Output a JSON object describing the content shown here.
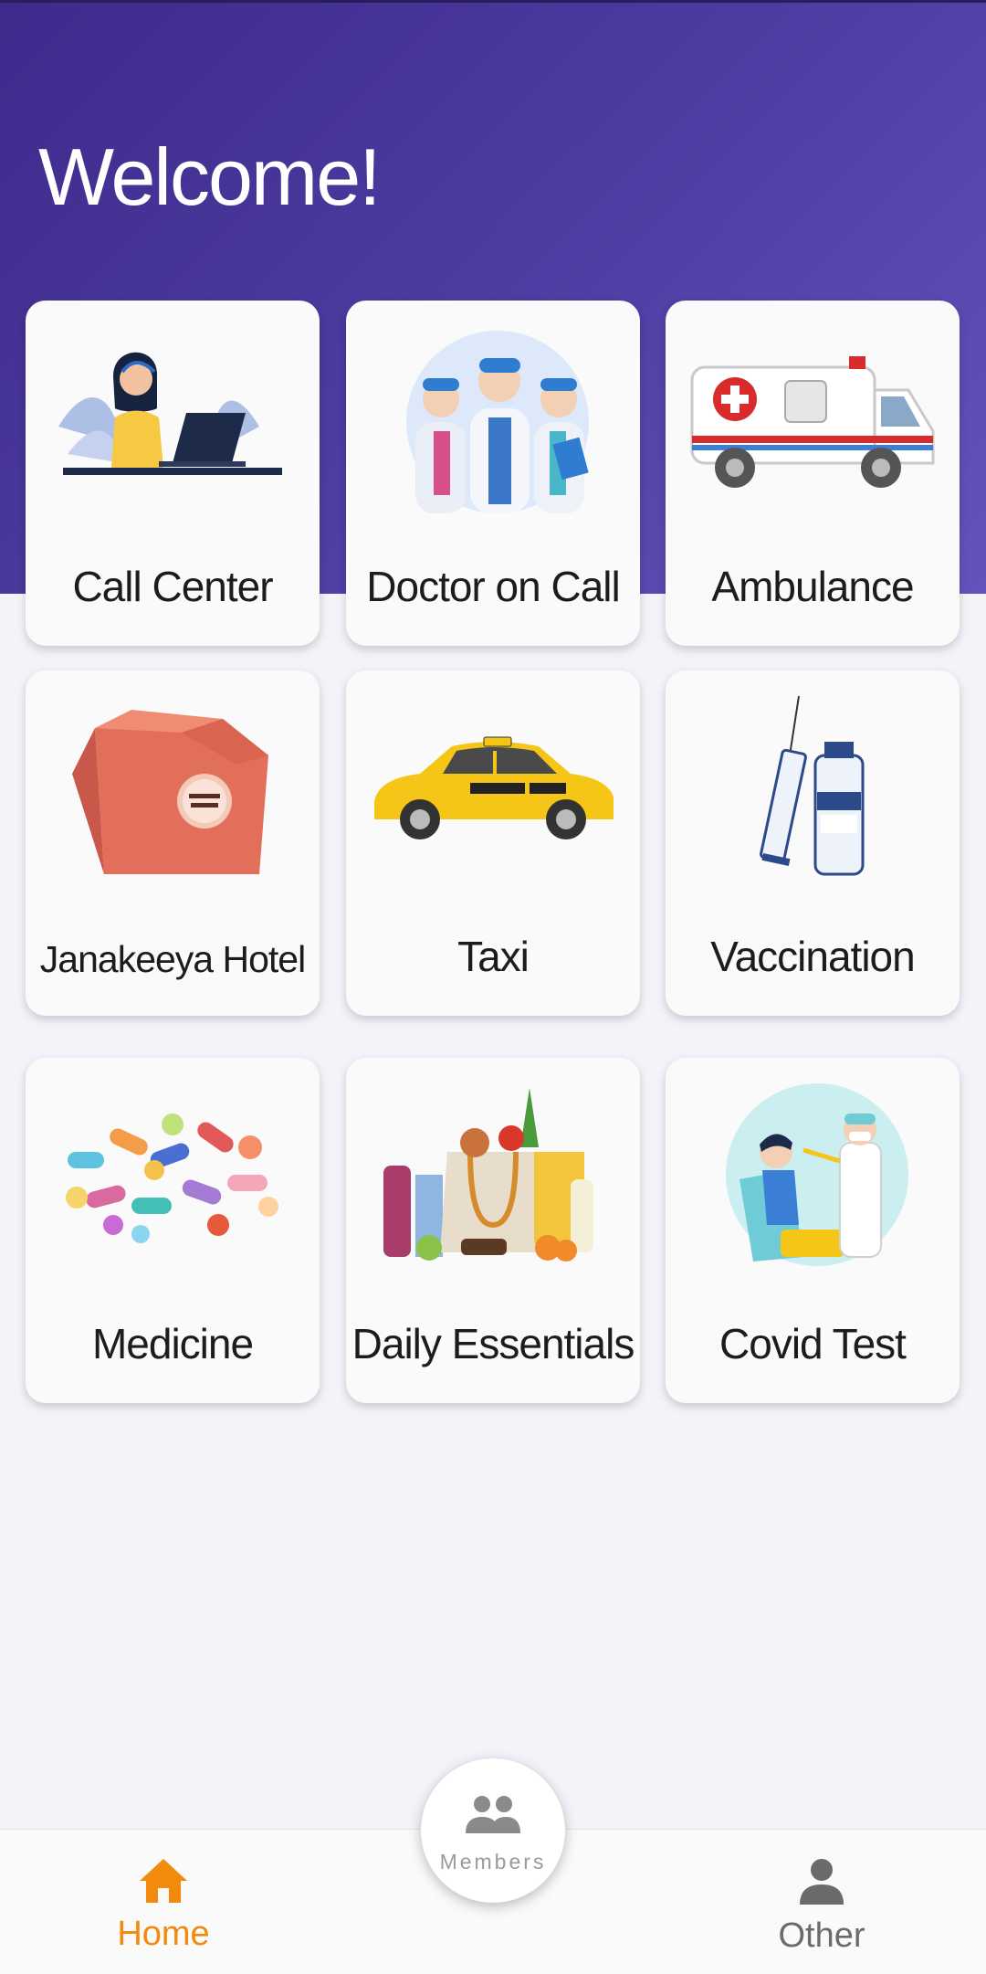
{
  "header": {
    "title": "Welcome!"
  },
  "services": [
    {
      "label": "Call Center",
      "icon": "call-center-agent-icon"
    },
    {
      "label": "Doctor on Call",
      "icon": "doctors-icon"
    },
    {
      "label": "Ambulance",
      "icon": "ambulance-icon"
    },
    {
      "label": "Janakeeya Hotel",
      "icon": "food-bag-icon"
    },
    {
      "label": "Taxi",
      "icon": "taxi-icon"
    },
    {
      "label": "Vaccination",
      "icon": "vaccine-icon"
    },
    {
      "label": "Medicine",
      "icon": "pills-icon"
    },
    {
      "label": "Daily Essentials",
      "icon": "groceries-icon"
    },
    {
      "label": "Covid Test",
      "icon": "covid-test-icon"
    }
  ],
  "bottom_nav": {
    "home_label": "Home",
    "members_label": "Members",
    "other_label": "Other"
  },
  "colors": {
    "header_gradient_start": "#3f2a8c",
    "header_gradient_end": "#6553bb",
    "active_nav": "#f28a0c",
    "inactive_nav": "#6b6b6b"
  }
}
